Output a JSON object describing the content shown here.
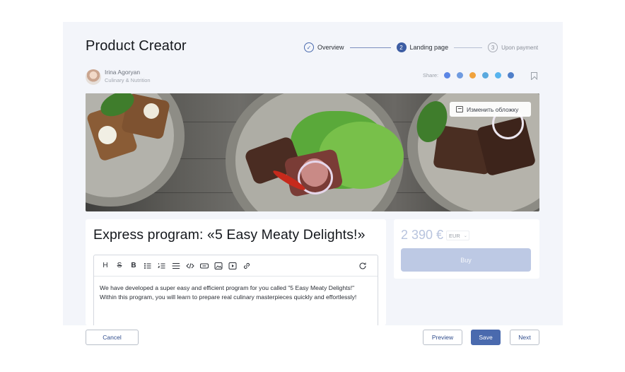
{
  "header": {
    "title": "Product Creator",
    "steps": [
      {
        "marker": "✓",
        "label": "Overview",
        "state": "done"
      },
      {
        "marker": "2",
        "label": "Landing page",
        "state": "active"
      },
      {
        "marker": "3",
        "label": "Upon payment",
        "state": "pending"
      }
    ]
  },
  "author": {
    "name": "Irina Agoryan",
    "role": "Culinary & Nutrition"
  },
  "share": {
    "label": "Share:",
    "networks": [
      {
        "icon": "facebook-icon",
        "color": "#5b86e5"
      },
      {
        "icon": "vk-icon",
        "color": "#6f9be0"
      },
      {
        "icon": "odnoklassniki-icon",
        "color": "#f0a23c"
      },
      {
        "icon": "telegram-icon",
        "color": "#5aa9de"
      },
      {
        "icon": "twitter-icon",
        "color": "#58b4ee"
      },
      {
        "icon": "linkedin-icon",
        "color": "#4f7fc9"
      }
    ]
  },
  "cover": {
    "change_label": "Изменить обложку"
  },
  "product": {
    "title": "Express program: «5 Easy Meaty Delights!»",
    "description": "We have developed a super easy and efficient program for you called \"5 Easy Meaty Delights!\" Within this program, you will learn to prepare real culinary masterpieces quickly and effortlessly!"
  },
  "editor": {
    "tools": [
      "heading",
      "strikethrough",
      "bold",
      "bulleted-list",
      "numbered-list",
      "divider",
      "code",
      "embed",
      "image",
      "video",
      "link"
    ],
    "heading_glyph": "H",
    "strike_glyph": "S",
    "bold_glyph": "B"
  },
  "pricing": {
    "price": "2 390 €",
    "currency": "EUR",
    "buy_label": "Buy"
  },
  "footer": {
    "cancel_label": "Cancel",
    "preview_label": "Preview",
    "save_label": "Save",
    "next_label": "Next"
  }
}
